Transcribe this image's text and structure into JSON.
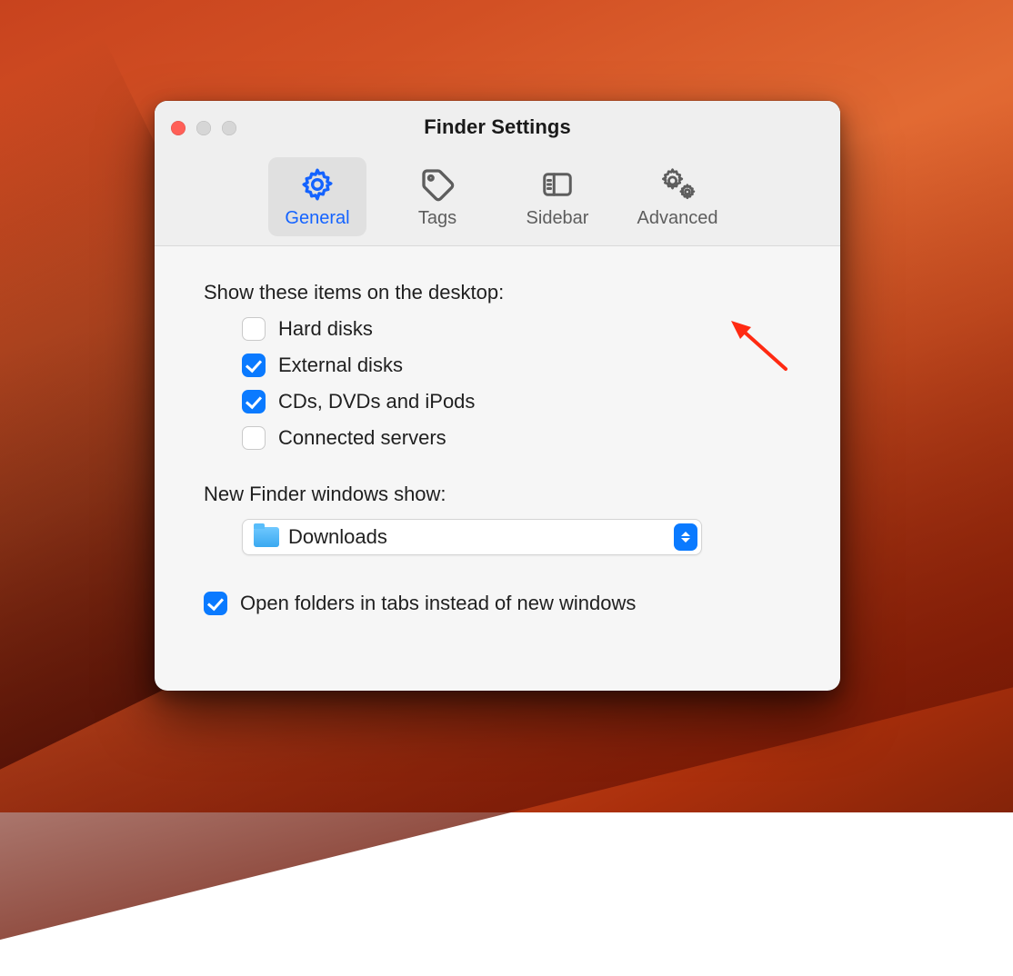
{
  "window": {
    "title": "Finder Settings"
  },
  "tabs": {
    "general": {
      "label": "General",
      "selected": true
    },
    "tags": {
      "label": "Tags",
      "selected": false
    },
    "sidebar": {
      "label": "Sidebar",
      "selected": false
    },
    "advanced": {
      "label": "Advanced",
      "selected": false
    }
  },
  "desktop_items": {
    "heading": "Show these items on the desktop:",
    "items": [
      {
        "label": "Hard disks",
        "checked": false
      },
      {
        "label": "External disks",
        "checked": true
      },
      {
        "label": "CDs, DVDs and iPods",
        "checked": true
      },
      {
        "label": "Connected servers",
        "checked": false
      }
    ]
  },
  "new_windows": {
    "heading": "New Finder windows show:",
    "selected": "Downloads"
  },
  "tabs_option": {
    "label": "Open folders in tabs instead of new windows",
    "checked": true
  }
}
